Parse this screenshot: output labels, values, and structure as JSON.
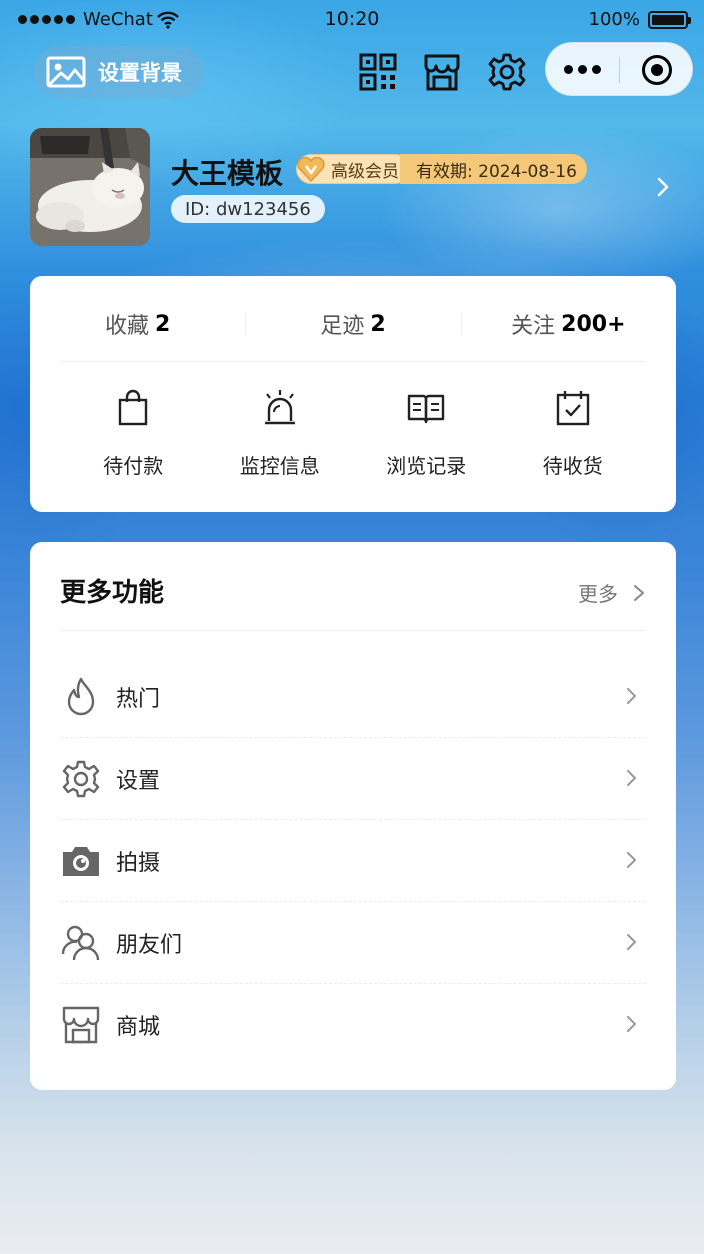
{
  "status_bar": {
    "carrier": "WeChat",
    "time": "10:20",
    "battery": "100%"
  },
  "toolbar": {
    "set_background_label": "设置背景",
    "icons": [
      "qr-code-icon",
      "store-icon",
      "gear-icon"
    ]
  },
  "profile": {
    "name": "大王模板",
    "vip_label": "高级会员",
    "expiry": "有效期: 2024-08-16",
    "id": "ID: dw123456"
  },
  "stats": [
    {
      "label": "收藏",
      "value": "2"
    },
    {
      "label": "足迹",
      "value": "2"
    },
    {
      "label": "关注",
      "value": "200+"
    }
  ],
  "quick_actions": [
    {
      "label": "待付款",
      "icon": "shopping-bag-icon"
    },
    {
      "label": "监控信息",
      "icon": "alarm-light-icon"
    },
    {
      "label": "浏览记录",
      "icon": "open-book-icon"
    },
    {
      "label": "待收货",
      "icon": "calendar-check-icon"
    }
  ],
  "more": {
    "title": "更多功能",
    "link_label": "更多",
    "items": [
      {
        "label": "热门",
        "icon": "flame-icon"
      },
      {
        "label": "设置",
        "icon": "gear-icon"
      },
      {
        "label": "拍摄",
        "icon": "camera-icon"
      },
      {
        "label": "朋友们",
        "icon": "friends-icon"
      },
      {
        "label": "商城",
        "icon": "store-icon"
      }
    ]
  },
  "colors": {
    "vip_bg": "#fbe3b6",
    "vip_expiry_bg": "#f3c878",
    "card_bg": "#ffffff"
  }
}
